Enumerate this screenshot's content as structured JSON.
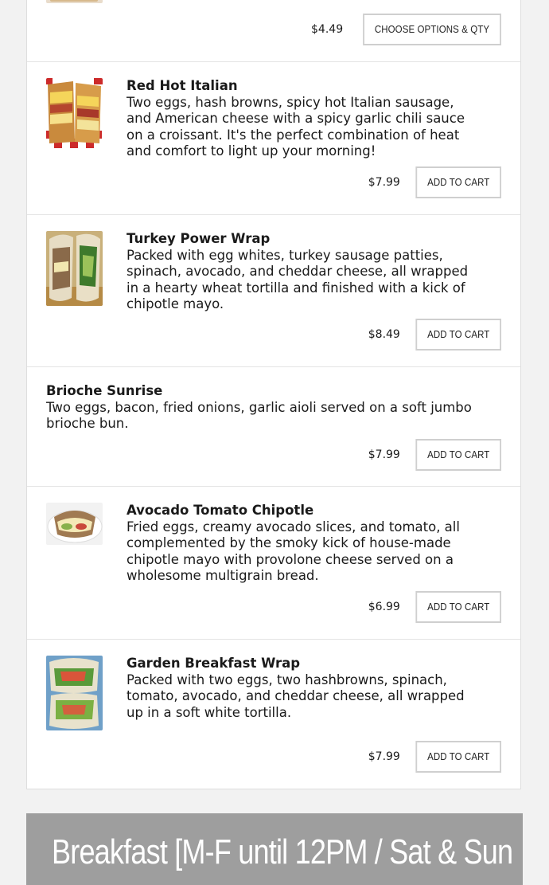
{
  "items": [
    {
      "title": "",
      "desc": "",
      "price": "$4.49",
      "button": "CHOOSE OPTIONS & QTY",
      "image": "sandwich-photo"
    },
    {
      "title": "Red Hot Italian",
      "desc": "Two eggs, hash browns, spicy hot Italian sausage, and American cheese with a spicy garlic chili sauce on a croissant. It's the perfect combination of heat and comfort to light up your morning!",
      "price": "$7.99",
      "button": "ADD TO CART",
      "image": "croissant-sandwich-photo"
    },
    {
      "title": "Turkey Power Wrap",
      "desc": "Packed with egg whites, turkey sausage patties, spinach, avocado, and cheddar cheese, all wrapped in a hearty wheat tortilla and finished with a kick of chipotle mayo.",
      "price": "$8.49",
      "button": "ADD TO CART",
      "image": "wrap-photo"
    },
    {
      "title": "Brioche Sunrise",
      "desc": "Two eggs, bacon, fried onions, garlic aioli served on a soft jumbo brioche bun.",
      "price": "$7.99",
      "button": "ADD TO CART",
      "image": ""
    },
    {
      "title": "Avocado Tomato Chipotle",
      "desc": "Fried eggs, creamy avocado slices, and tomato, all complemented by the smoky kick of house-made chipotle mayo with provolone cheese served on a wholesome multigrain bread.",
      "price": "$6.99",
      "button": "ADD TO CART",
      "image": "multigrain-sandwich-photo"
    },
    {
      "title": "Garden Breakfast Wrap",
      "desc": "Packed with two eggs, two hashbrowns, spinach, tomato, avocado, and cheddar cheese, all wrapped up in a soft white tortilla.",
      "price": "$7.99",
      "button": "ADD TO CART",
      "image": "veggie-wrap-photo"
    }
  ],
  "category": {
    "title": "Breakfast [M-F until 12PM / Sat & Sun"
  },
  "colors": {
    "category_bg": "#9e9e9e",
    "card_bg": "#ffffff",
    "page_bg": "#f2f2f2"
  }
}
